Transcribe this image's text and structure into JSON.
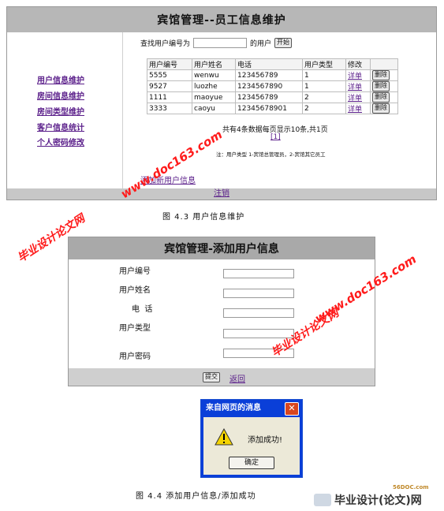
{
  "fig1": {
    "title": "宾馆管理--员工信息维护",
    "sidebar": [
      "用户信息维护",
      "房间信息维护",
      "房间类型维护",
      "客户信息统计",
      "个人密码修改"
    ],
    "search": {
      "prefix": "查找用户编号为",
      "value": "",
      "suffix": "的用户",
      "button": "开始"
    },
    "table": {
      "headers": [
        "用户编号",
        "用户姓名",
        "电话",
        "用户类型",
        "修改",
        ""
      ],
      "rows": [
        [
          "5555",
          "wenwu",
          "123456789",
          "1",
          "详单",
          "删除"
        ],
        [
          "9527",
          "luozhe",
          "1234567890",
          "1",
          "详单",
          "删除"
        ],
        [
          "1111",
          "maoyue",
          "123456789",
          "2",
          "详单",
          "删除"
        ],
        [
          "3333",
          "caoyu",
          "12345678901",
          "2",
          "详单",
          "删除"
        ]
      ]
    },
    "summary": "共有4条数据每页显示10条,共1页",
    "pager": "[1]",
    "note": "注：用户类型 1-宾馆总管理员，2-宾馆其它员工",
    "add_link": "添加新用户信息",
    "logout": "注销",
    "caption": "图 4.3  用户信息维护"
  },
  "fig2": {
    "title": "宾馆管理-添加用户信息",
    "labels": [
      "用户编号",
      "用户姓名",
      "电  话",
      "用户类型",
      "用户密码"
    ],
    "submit": "提交",
    "back": "返回",
    "caption": "图 4.4  添加用户信息/添加成功"
  },
  "dialog": {
    "title": "来自网页的消息",
    "message": "添加成功!",
    "ok": "确定",
    "close_icon": "close-icon",
    "warn_icon": "warning-icon"
  },
  "watermarks": {
    "doc1": "www.doc163.com",
    "doc2": "www.doc163.com",
    "bysj1": "毕业设计论文网",
    "bysj2": "毕业设计论文网",
    "logo": "毕业设计(论文)网",
    "logo_small": "56DOC.com"
  }
}
